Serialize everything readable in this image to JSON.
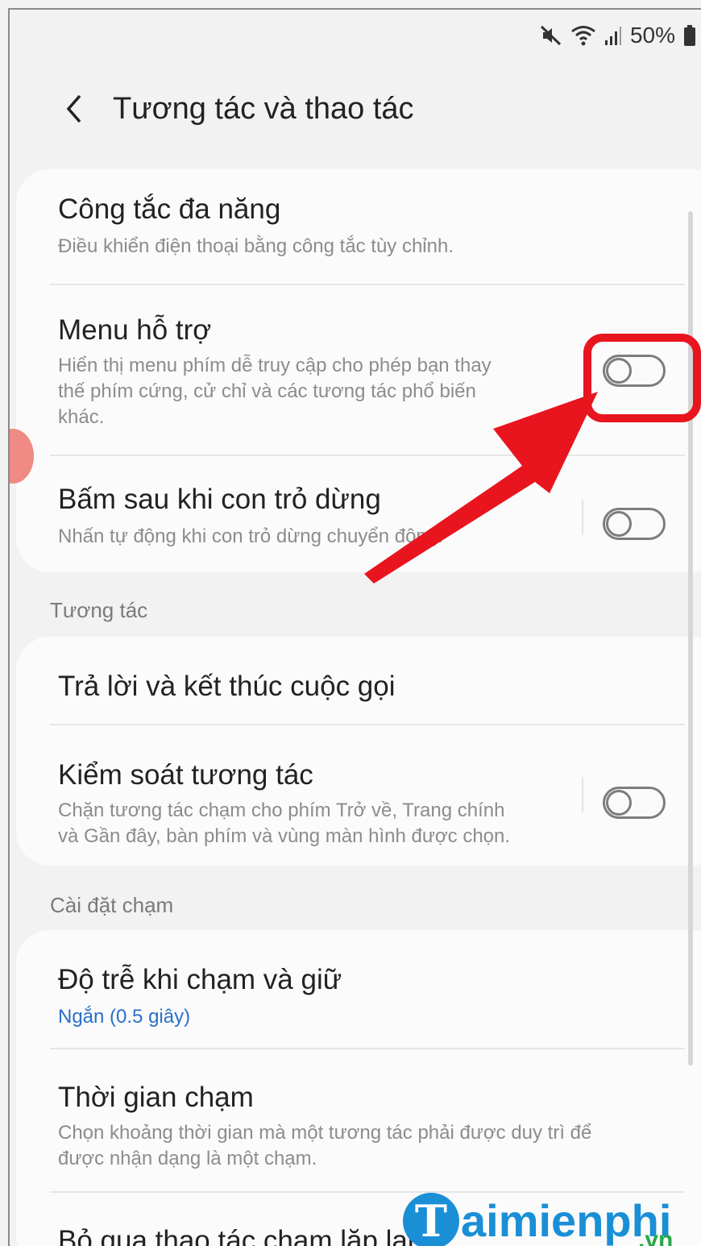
{
  "status_bar": {
    "battery_percent": "50%",
    "icons": [
      "mute-icon",
      "wifi-icon",
      "signal-icon",
      "battery-icon"
    ]
  },
  "header": {
    "back_icon": "chevron-left-icon",
    "title": "Tương tác và thao tác"
  },
  "group1": {
    "items": [
      {
        "title": "Công tắc đa năng",
        "subtitle": "Điều khiển điện thoại bằng công tắc tùy chỉnh."
      },
      {
        "title": "Menu hỗ trợ",
        "subtitle_lines": [
          "Hiển thị menu phím dễ truy cập cho phép bạn thay",
          "thế phím cứng, cử chỉ và các tương tác phổ biến",
          "khác."
        ],
        "toggle": false
      },
      {
        "title": "Bấm sau khi con trỏ dừng",
        "subtitle": "Nhấn tự động khi con trỏ dừng chuyển động.",
        "toggle": false
      }
    ]
  },
  "section_interaction": {
    "label": "Tương tác"
  },
  "group2": {
    "items": [
      {
        "title": "Trả lời và kết thúc cuộc gọi"
      },
      {
        "title": "Kiểm soát tương tác",
        "subtitle_lines": [
          "Chặn tương tác chạm cho phím Trở về, Trang chính",
          "và Gần đây, bàn phím và vùng màn hình được chọn."
        ],
        "toggle": false
      }
    ]
  },
  "section_touch": {
    "label": "Cài đặt chạm"
  },
  "group3": {
    "items": [
      {
        "title": "Độ trễ khi chạm và giữ",
        "value": "Ngắn (0.5 giây)"
      },
      {
        "title": "Thời gian chạm",
        "subtitle_lines": [
          "Chọn khoảng thời gian mà một tương tác phải được duy trì để",
          "được nhận dạng là một chạm."
        ]
      },
      {
        "title": "Bỏ qua thao tác chạm lặp lại"
      }
    ]
  },
  "colors": {
    "annotation_red": "#e8151f",
    "link_blue": "#2a6fc9"
  },
  "watermark": {
    "brand": "aimienphi",
    "logo_letter": "T",
    "suffix": ".vn"
  }
}
